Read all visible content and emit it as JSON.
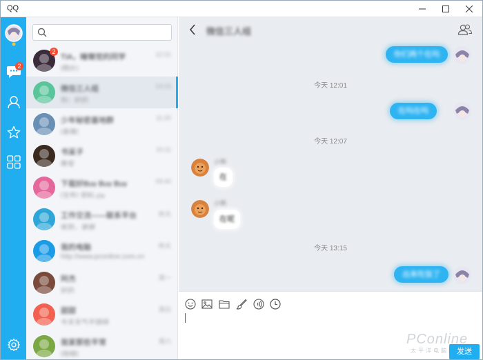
{
  "window": {
    "title": "QQ"
  },
  "nav": {
    "messages_badge": "2"
  },
  "search": {
    "placeholder": ""
  },
  "conversations": [
    {
      "name": "TIA，睡懒觉的同学",
      "preview": "[图片]",
      "time": "12:21",
      "badge": "2",
      "color": "#3a2a3a"
    },
    {
      "name": "微信三人组",
      "preview": "你：好的",
      "time": "13:15",
      "color": "#5ac59a"
    },
    {
      "name": "少年秘密基地群",
      "preview": "[表情]",
      "time": "11:20",
      "color": "#6a8fb5"
    },
    {
      "name": "书呆子",
      "preview": "晚安",
      "time": "10:11",
      "color": "#3b2a20"
    },
    {
      "name": "下载好Buy Buy Buy",
      "preview": "[文件] 资料.zip",
      "time": "09:40",
      "color": "#e4689b"
    },
    {
      "name": "工作交流——联系平台",
      "preview": "收到，谢谢",
      "time": "昨天",
      "color": "#2ea6d8"
    },
    {
      "name": "我的电脑",
      "preview": "http://www.pconline.com.cn",
      "time": "昨天",
      "color": "#1a9be6"
    },
    {
      "name": "阿杰",
      "preview": "好的",
      "time": "周一",
      "color": "#7a4a3a"
    },
    {
      "name": "甜甜",
      "preview": "今天天气不错呀",
      "time": "周日",
      "color": "#f2604f"
    },
    {
      "name": "我家那些平常",
      "preview": "[视频]",
      "time": "周六",
      "color": "#7ba844"
    }
  ],
  "chat": {
    "title": "微信三人组",
    "messages": [
      {
        "type": "out",
        "text": "你们两个在吗"
      },
      {
        "type": "time",
        "text": "今天 12:01"
      },
      {
        "type": "out",
        "text": "在吗在吗"
      },
      {
        "type": "time",
        "text": "今天 12:07"
      },
      {
        "type": "in",
        "sender": "小熊",
        "text": "在"
      },
      {
        "type": "in",
        "sender": "小熊",
        "text": "在呢"
      },
      {
        "type": "time",
        "text": "今天 13:15"
      },
      {
        "type": "out",
        "text": "出来吃饭了"
      }
    ]
  },
  "composer": {
    "send_label": "发送"
  },
  "watermark": {
    "brand": "PConline",
    "sub": "太平洋电脑网"
  },
  "colors": {
    "accent": "#20aef0",
    "badge": "#f74c31",
    "bubble": "#2fb4f2"
  }
}
